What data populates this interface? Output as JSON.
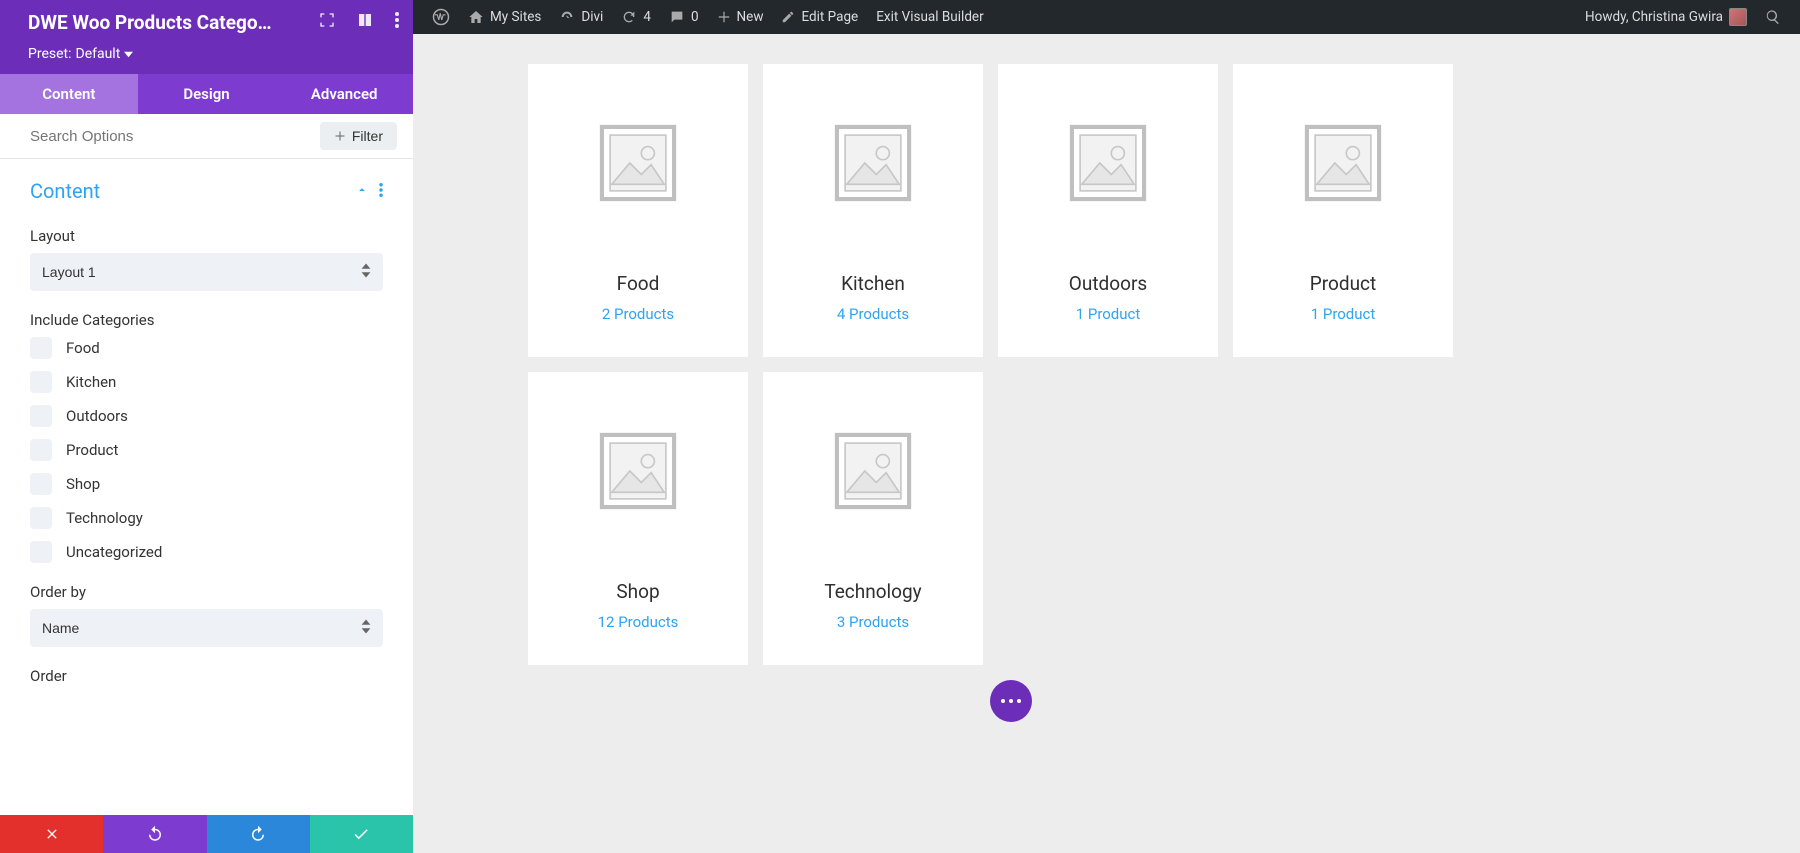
{
  "panel": {
    "title": "DWE Woo Products Catego…",
    "preset_label": "Preset:",
    "preset_value": "Default"
  },
  "tabs": {
    "content": "Content",
    "design": "Design",
    "advanced": "Advanced"
  },
  "search": {
    "placeholder": "Search Options",
    "filter_label": "Filter"
  },
  "section": {
    "content_heading": "Content"
  },
  "form": {
    "layout_label": "Layout",
    "layout_value": "Layout 1",
    "include_label": "Include Categories",
    "categories": [
      "Food",
      "Kitchen",
      "Outdoors",
      "Product",
      "Shop",
      "Technology",
      "Uncategorized"
    ],
    "orderby_label": "Order by",
    "orderby_value": "Name",
    "order_label": "Order"
  },
  "wpbar": {
    "my_sites": "My Sites",
    "divi": "Divi",
    "refresh_count": "4",
    "comments_count": "0",
    "new": "New",
    "edit_page": "Edit Page",
    "exit_vb": "Exit Visual Builder",
    "howdy": "Howdy, Christina Gwira"
  },
  "cards": [
    {
      "name": "Food",
      "count": "2 Products"
    },
    {
      "name": "Kitchen",
      "count": "4 Products"
    },
    {
      "name": "Outdoors",
      "count": "1 Product"
    },
    {
      "name": "Product",
      "count": "1 Product"
    },
    {
      "name": "Shop",
      "count": "12 Products"
    },
    {
      "name": "Technology",
      "count": "3 Products"
    }
  ]
}
